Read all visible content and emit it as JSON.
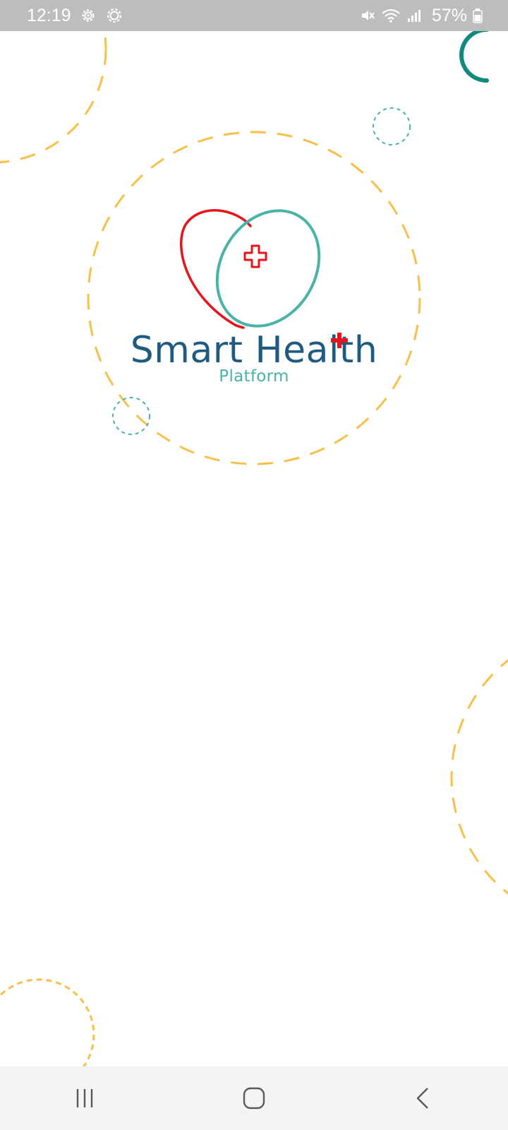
{
  "status_bar": {
    "time": "12:19",
    "left_icons": [
      "settings-gear-icon",
      "settings-gear-outline-icon"
    ],
    "right_icons": [
      "mute-icon",
      "wifi-icon",
      "signal-icon"
    ],
    "battery_percent": "57%"
  },
  "app": {
    "brand_name": "Smart Health",
    "brand_sub": "Platform"
  },
  "colors": {
    "brand_blue": "#1f5b80",
    "brand_teal": "#4ab3a7",
    "brand_red": "#e8141c",
    "decor_yellow": "#f7c04a",
    "spinner": "#0e8a7e"
  },
  "nav_bar": {
    "buttons": [
      "recent-apps",
      "home",
      "back"
    ]
  }
}
